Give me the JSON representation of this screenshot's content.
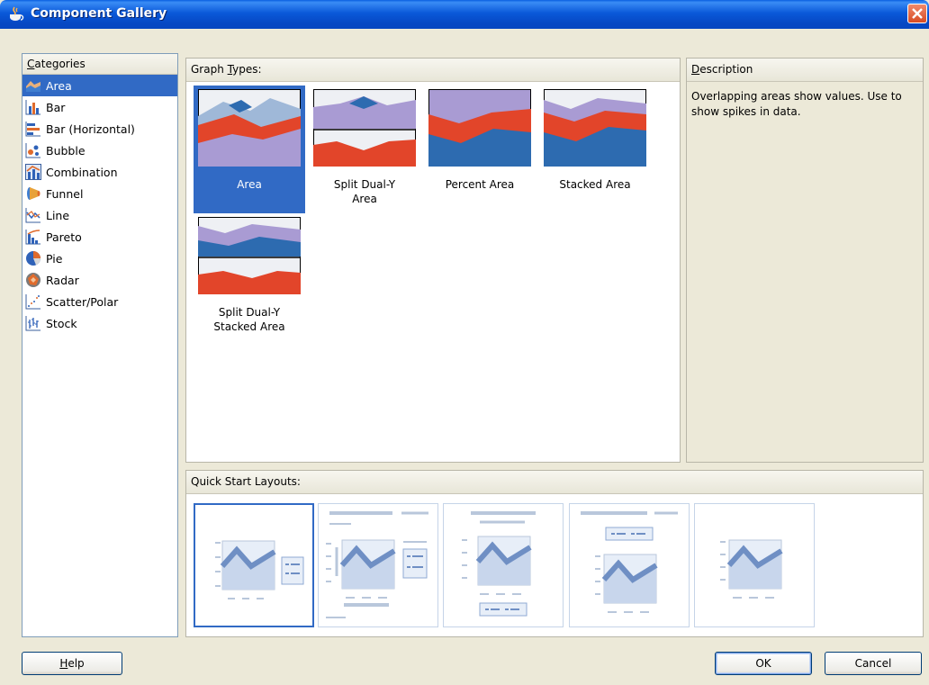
{
  "window": {
    "title": "Component Gallery"
  },
  "categories": {
    "header": "Categories",
    "items": [
      {
        "label": "Area",
        "icon": "area-chart-icon",
        "selected": true
      },
      {
        "label": "Bar",
        "icon": "bar-chart-icon",
        "selected": false
      },
      {
        "label": "Bar (Horizontal)",
        "icon": "horizontal-bar-chart-icon",
        "selected": false
      },
      {
        "label": "Bubble",
        "icon": "bubble-chart-icon",
        "selected": false
      },
      {
        "label": "Combination",
        "icon": "combination-chart-icon",
        "selected": false
      },
      {
        "label": "Funnel",
        "icon": "funnel-chart-icon",
        "selected": false
      },
      {
        "label": "Line",
        "icon": "line-chart-icon",
        "selected": false
      },
      {
        "label": "Pareto",
        "icon": "pareto-chart-icon",
        "selected": false
      },
      {
        "label": "Pie",
        "icon": "pie-chart-icon",
        "selected": false
      },
      {
        "label": "Radar",
        "icon": "radar-chart-icon",
        "selected": false
      },
      {
        "label": "Scatter/Polar",
        "icon": "scatter-chart-icon",
        "selected": false
      },
      {
        "label": "Stock",
        "icon": "stock-chart-icon",
        "selected": false
      }
    ]
  },
  "graph_types": {
    "header": "Graph Types:",
    "items": [
      {
        "label": "Area",
        "thumb": "area",
        "selected": true
      },
      {
        "label": "Split Dual-Y\nArea",
        "thumb": "split-dual-y-area",
        "selected": false
      },
      {
        "label": "Percent Area",
        "thumb": "percent-area",
        "selected": false
      },
      {
        "label": "Stacked Area",
        "thumb": "stacked-area",
        "selected": false
      },
      {
        "label": "Split Dual-Y\nStacked Area",
        "thumb": "split-dual-y-stacked-area",
        "selected": false
      }
    ]
  },
  "description": {
    "header": "Description",
    "text": "Overlapping areas show values. Use to show spikes in data."
  },
  "quick_start": {
    "header": "Quick Start Layouts:",
    "layouts": [
      {
        "name": "legend-right",
        "selected": true
      },
      {
        "name": "title-legend-right-footer",
        "selected": false
      },
      {
        "name": "title-legend-bottom",
        "selected": false
      },
      {
        "name": "title-legend-top",
        "selected": false
      },
      {
        "name": "chart-only",
        "selected": false
      }
    ]
  },
  "buttons": {
    "help": "Help",
    "ok": "OK",
    "cancel": "Cancel"
  },
  "colors": {
    "selection": "#316ac5",
    "titlebar": "#0a59d9",
    "area_red": "#e2452a",
    "area_purple": "#a99bd3",
    "area_blue": "#2d6bb0"
  }
}
